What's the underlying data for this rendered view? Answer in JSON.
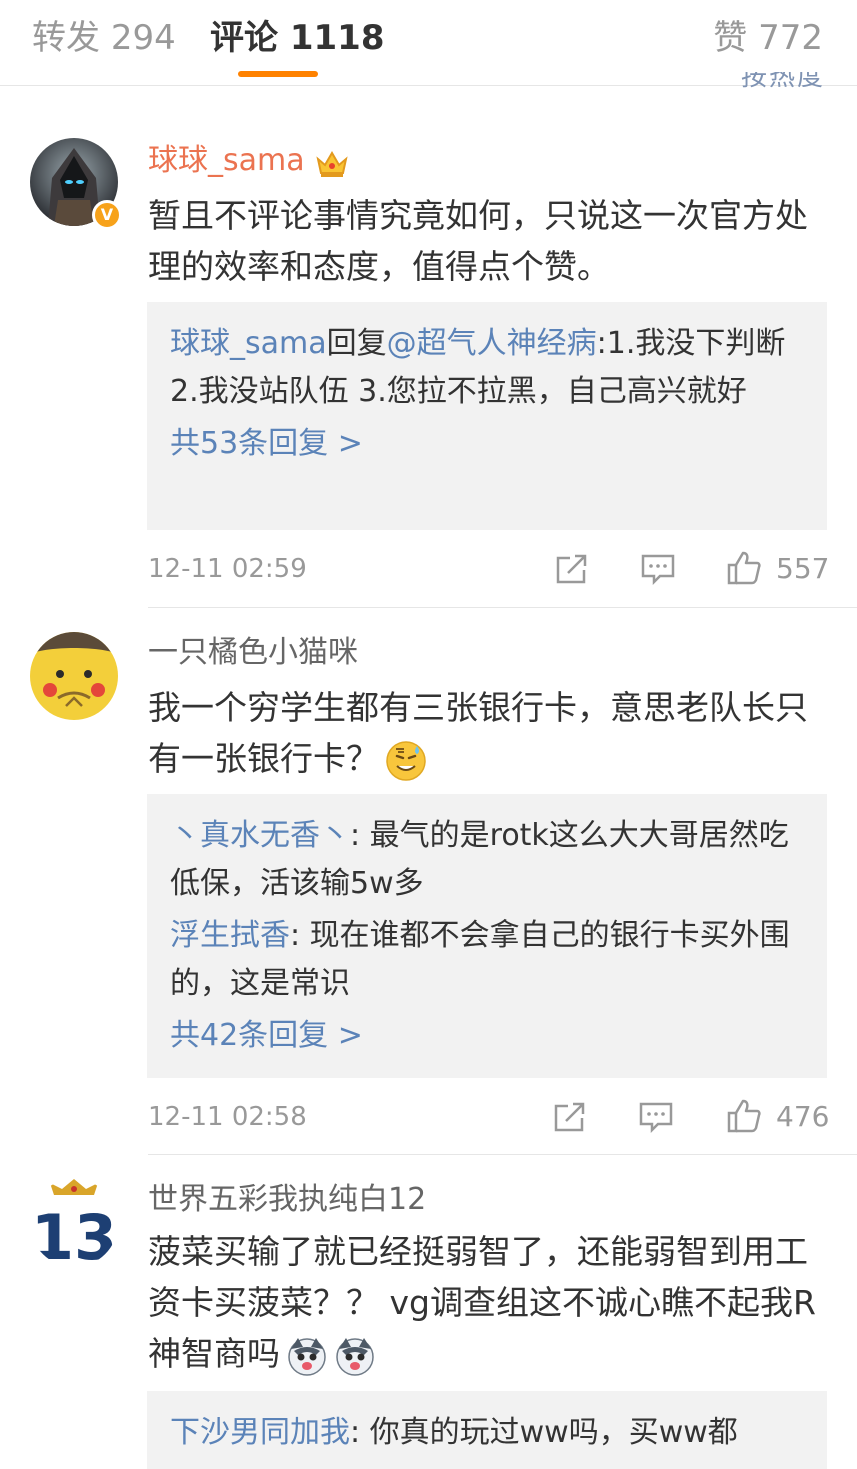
{
  "tabs": {
    "repost": {
      "label": "转发",
      "count": "294"
    },
    "comment": {
      "label": "评论",
      "count": "1118"
    },
    "like": {
      "label": "赞",
      "count": "772"
    }
  },
  "sort_fragment": "按热度",
  "accent_color": "#ff8200",
  "link_color": "#5b83b8",
  "comments": [
    {
      "username": "球球_sama",
      "verified_badge": "V",
      "content": "暂且不评论事情究竟如何，只说这一次官方处理的效率和态度，值得点个赞。",
      "replies": [
        {
          "user": "球球_sama",
          "reply_word": "回复",
          "at": "@超气人神经病",
          "text": ":1.我没下判断  2.我没站队伍 3.您拉不拉黑，自己高兴就好"
        }
      ],
      "more_replies": "共53条回复 >",
      "time": "12-11 02:59",
      "likes": "557"
    },
    {
      "username": "一只橘色小猫咪",
      "content": "我一个穷学生都有三张银行卡，意思老队长只有一张银行卡？",
      "replies": [
        {
          "user": "丶真水无香丶",
          "text": ": 最气的是rotk这么大大哥居然吃低保，活该输5w多"
        },
        {
          "user": "浮生拭香",
          "text": ": 现在谁都不会拿自己的银行卡买外围的，这是常识"
        }
      ],
      "more_replies": "共42条回复 >",
      "time": "12-11 02:58",
      "likes": "476"
    },
    {
      "username": "世界五彩我执纯白12",
      "content": "菠菜买输了就已经挺弱智了，还能弱智到用工资卡买菠菜？？ vg调查组这不诚心瞧不起我R神智商吗",
      "replies": [
        {
          "user": "下沙男同加我",
          "text": ": 你真的玩过ww吗，买ww都"
        }
      ],
      "avatar_text": "13"
    }
  ]
}
